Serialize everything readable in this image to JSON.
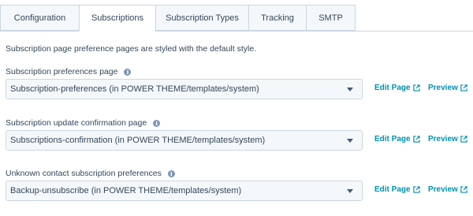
{
  "tabs": [
    {
      "label": "Configuration",
      "active": false
    },
    {
      "label": "Subscriptions",
      "active": true
    },
    {
      "label": "Subscription Types",
      "active": false
    },
    {
      "label": "Tracking",
      "active": false
    },
    {
      "label": "SMTP",
      "active": false
    }
  ],
  "intro": "Subscription page preference pages are styled with the default style.",
  "fields": [
    {
      "label": "Subscription preferences page",
      "value": "Subscription-preferences (in POWER THEME/templates/system)",
      "edit_label": "Edit Page",
      "preview_label": "Preview"
    },
    {
      "label": "Subscription update confirmation page",
      "value": "Subscriptions-confirmation (in POWER THEME/templates/system)",
      "edit_label": "Edit Page",
      "preview_label": "Preview"
    },
    {
      "label": "Unknown contact subscription preferences",
      "value": "Backup-unsubscribe (in POWER THEME/templates/system)",
      "edit_label": "Edit Page",
      "preview_label": "Preview"
    }
  ],
  "info_glyph": "i",
  "colors": {
    "link": "#0091ae",
    "text": "#33475b",
    "border": "#cbd6e2",
    "tab_bg": "#f5f8fa"
  }
}
